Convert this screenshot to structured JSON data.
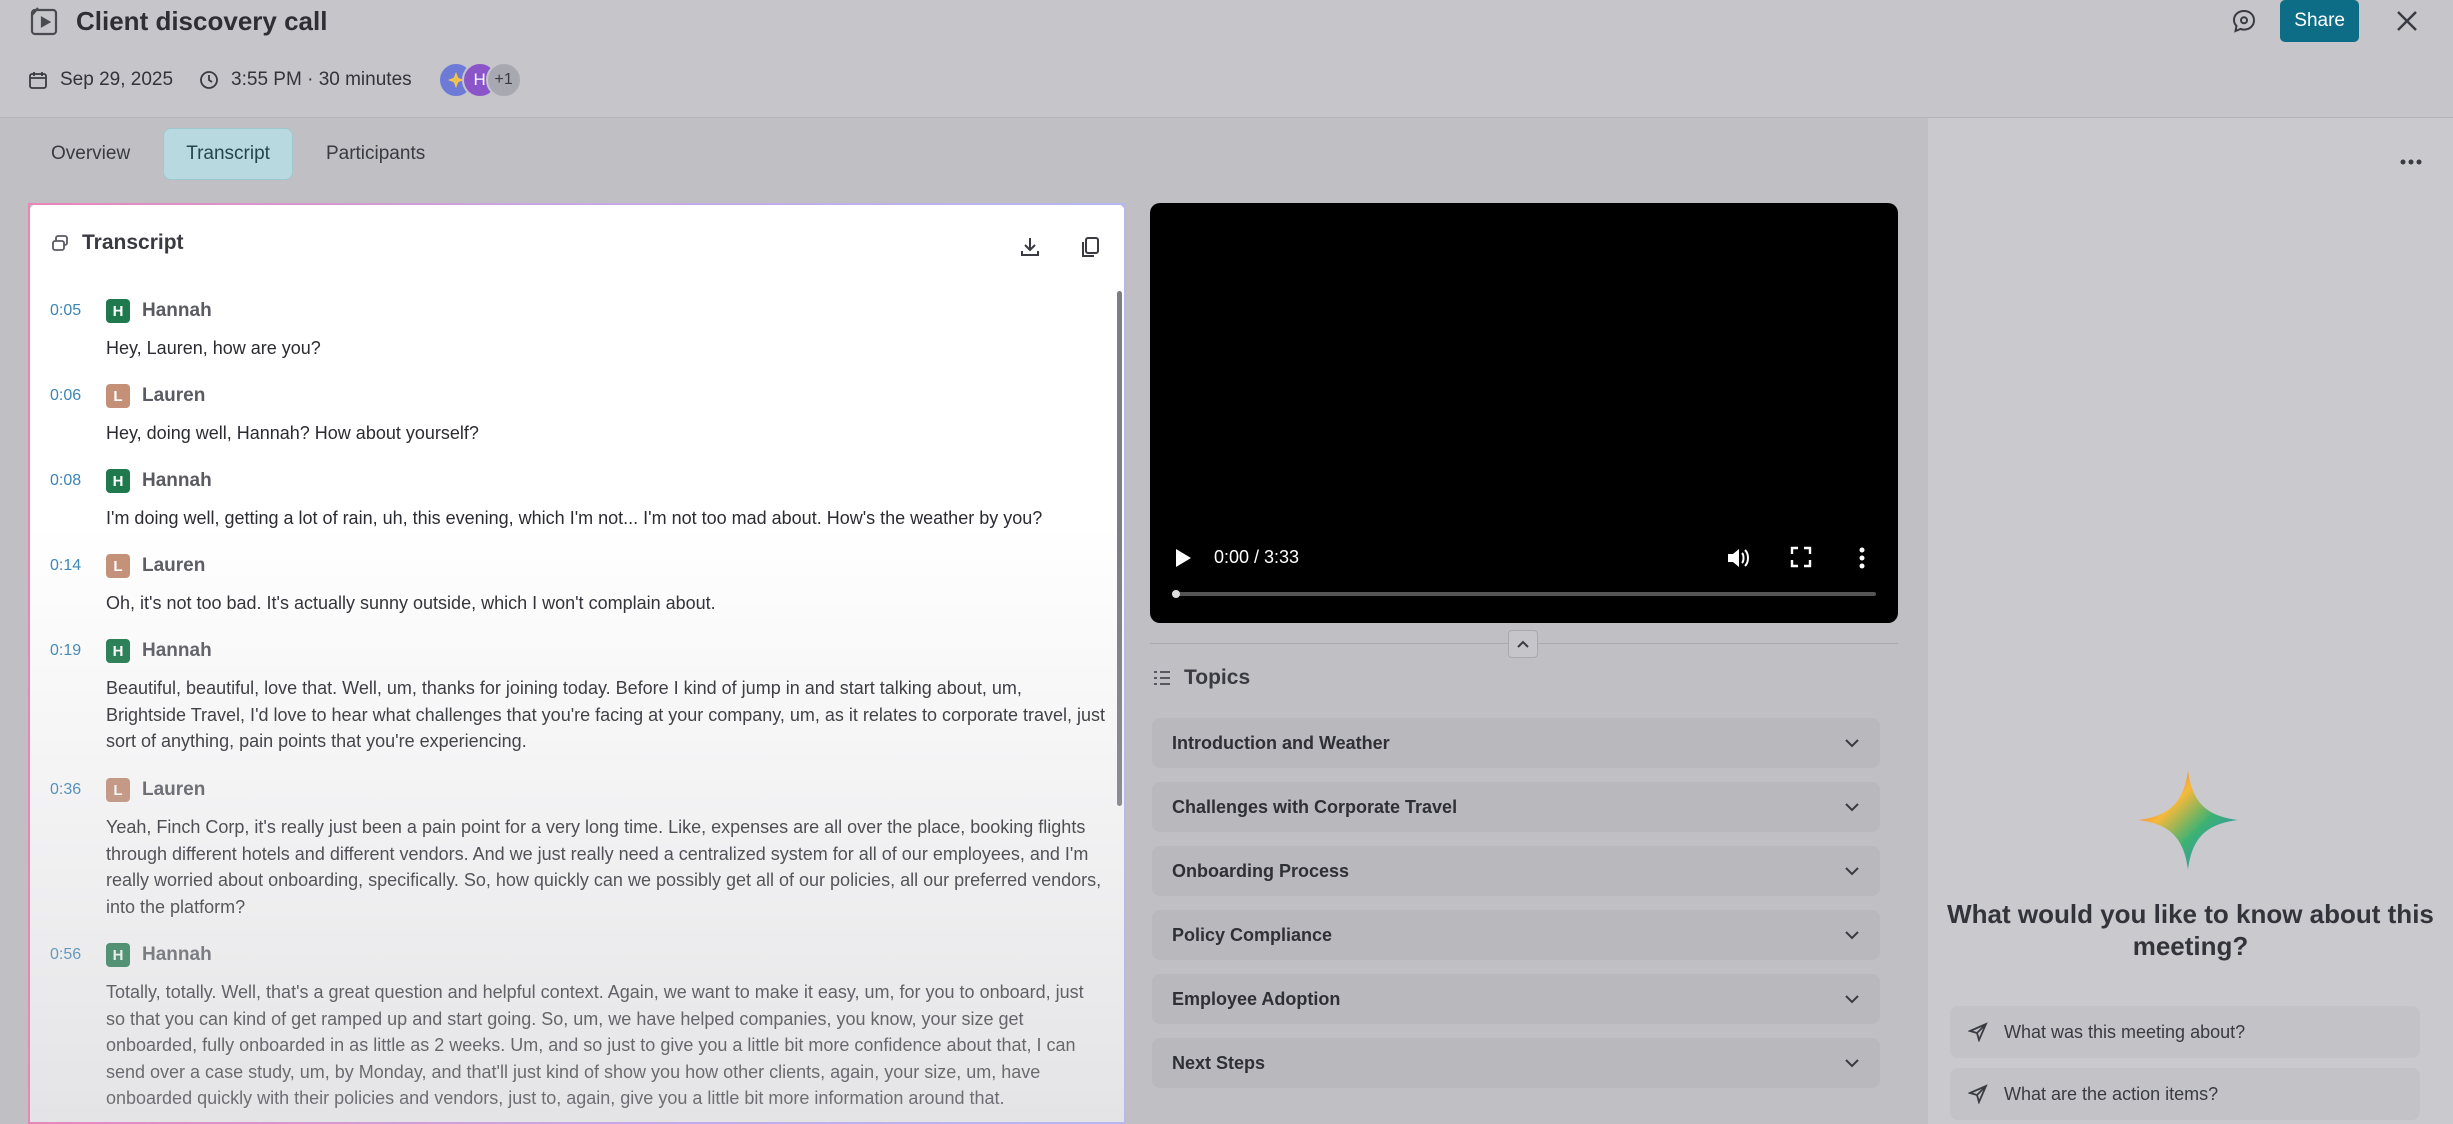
{
  "header": {
    "title": "Client discovery call",
    "date": "Sep 29, 2025",
    "time": "3:55 PM · 30 minutes",
    "avatars": [
      {
        "initial": ""
      },
      {
        "initial": "H"
      },
      {
        "initial": "+1"
      }
    ],
    "share_label": "Share"
  },
  "tabs": [
    {
      "label": "Overview",
      "active": false
    },
    {
      "label": "Transcript",
      "active": true
    },
    {
      "label": "Participants",
      "active": false
    }
  ],
  "transcript": {
    "title": "Transcript",
    "entries": [
      {
        "time": "0:05",
        "initial": "H",
        "speaker": "Hannah",
        "text": "Hey, Lauren, how are you?"
      },
      {
        "time": "0:06",
        "initial": "L",
        "speaker": "Lauren",
        "text": "Hey, doing well, Hannah? How about yourself?"
      },
      {
        "time": "0:08",
        "initial": "H",
        "speaker": "Hannah",
        "text": "I'm doing well, getting a lot of rain, uh, this evening, which I'm not... I'm not too mad about. How's the weather by you?"
      },
      {
        "time": "0:14",
        "initial": "L",
        "speaker": "Lauren",
        "text": "Oh, it's not too bad. It's actually sunny outside, which I won't complain about."
      },
      {
        "time": "0:19",
        "initial": "H",
        "speaker": "Hannah",
        "text": "Beautiful, beautiful, love that. Well, um, thanks for joining today. Before I kind of jump in and start talking about, um, Brightside Travel, I'd love to hear what challenges that you're facing at your company, um, as it relates to corporate travel, just sort of anything, pain points that you're experiencing."
      },
      {
        "time": "0:36",
        "initial": "L",
        "speaker": "Lauren",
        "text": "Yeah, Finch Corp, it's really just been a pain point for a very long time. Like, expenses are all over the place, booking flights through different hotels and different vendors. And we just really need a centralized system for all of our employees, and I'm really worried about onboarding, specifically. So, how quickly can we possibly get all of our policies, all our preferred vendors, into the platform?"
      },
      {
        "time": "0:56",
        "initial": "H",
        "speaker": "Hannah",
        "text": "Totally, totally. Well, that's a great question and helpful context. Again, we want to make it easy, um, for you to onboard, just so that you can kind of get ramped up and start going. So, um, we have helped companies, you know, your size get onboarded, fully onboarded in as little as 2 weeks. Um, and so just to give you a little bit more confidence about that, I can send over a case study, um, by Monday, and that'll just kind of show you how other clients, again, your size, um, have onboarded quickly with their policies and vendors, just to, again, give you a little bit more information around that."
      }
    ]
  },
  "video": {
    "time_display": "0:00 / 3:33",
    "progress": 0
  },
  "topics": {
    "title": "Topics",
    "items": [
      "Introduction and Weather",
      "Challenges with Corporate Travel",
      "Onboarding Process",
      "Policy Compliance",
      "Employee Adoption",
      "Next Steps"
    ]
  },
  "assistant": {
    "heading": "What would you like to know about this meeting?",
    "suggestions": [
      "What was this meeting about?",
      "What are the action items?"
    ]
  }
}
